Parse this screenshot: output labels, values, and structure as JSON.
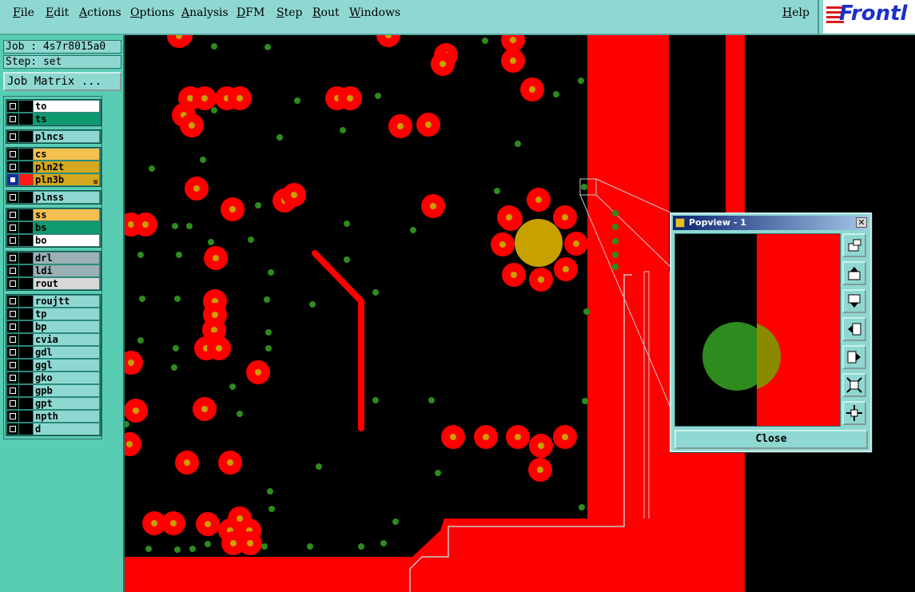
{
  "menu": {
    "file": "File",
    "edit": "Edit",
    "actions": "Actions",
    "options": "Options",
    "analysis": "Analysis",
    "dfm": "DFM",
    "step": "Step",
    "rout": "Rout",
    "windows": "Windows",
    "help": "Help"
  },
  "brand": {
    "logo_text": "Frontl",
    "logo_color": "#1a2fc8",
    "accent": "#d81a1a"
  },
  "job": {
    "job_line": "Job : 4s7r8015a0",
    "step_line": "Step: set",
    "matrix_button": "Job Matrix ..."
  },
  "layers": {
    "groups": [
      [
        {
          "name": "to",
          "color": "#ffffff",
          "checked": false
        },
        {
          "name": "ts",
          "color": "#0e9a6e",
          "checked": false
        }
      ],
      [
        {
          "name": "plncs",
          "color": "#8fd8d2",
          "checked": false
        }
      ],
      [
        {
          "name": "cs",
          "color": "#f4c050",
          "checked": false
        },
        {
          "name": "pln2t",
          "color": "#d4a820",
          "checked": false
        },
        {
          "name": "pln3b",
          "color": "#d4a820",
          "checked": true
        }
      ],
      [
        {
          "name": "plnss",
          "color": "#8fd8d2",
          "checked": false
        }
      ],
      [
        {
          "name": "ss",
          "color": "#f4c050",
          "checked": false
        },
        {
          "name": "bs",
          "color": "#0e9a6e",
          "checked": false
        },
        {
          "name": "bo",
          "color": "#ffffff",
          "checked": false
        }
      ],
      [
        {
          "name": "drl",
          "color": "#9ab0b4",
          "checked": false
        },
        {
          "name": "ldi",
          "color": "#9ab0b4",
          "checked": false
        },
        {
          "name": "rout",
          "color": "#d8d8d8",
          "checked": false
        }
      ],
      [
        {
          "name": "roujtt",
          "color": "#8fd8d2",
          "checked": false
        },
        {
          "name": "tp",
          "color": "#8fd8d2",
          "checked": false
        },
        {
          "name": "bp",
          "color": "#8fd8d2",
          "checked": false
        },
        {
          "name": "cvia",
          "color": "#8fd8d2",
          "checked": false
        },
        {
          "name": "gdl",
          "color": "#8fd8d2",
          "checked": false
        },
        {
          "name": "ggl",
          "color": "#8fd8d2",
          "checked": false
        },
        {
          "name": "gko",
          "color": "#8fd8d2",
          "checked": false
        },
        {
          "name": "gpb",
          "color": "#8fd8d2",
          "checked": false
        },
        {
          "name": "gpt",
          "color": "#8fd8d2",
          "checked": false
        },
        {
          "name": "npth",
          "color": "#8fd8d2",
          "checked": false
        },
        {
          "name": "d",
          "color": "#8fd8d2",
          "checked": false
        }
      ]
    ],
    "active_swatch_color": "#ff1a1a"
  },
  "canvas": {
    "copper_color": "#ff0000",
    "drill_color": "#2e8b1e",
    "pad_center_color": "#c8a000",
    "background": "#000000"
  },
  "popview": {
    "title": "Popview - 1",
    "close_label": "Close",
    "tools": [
      "zoom-window-icon",
      "pan-up-icon",
      "pan-down-icon",
      "pan-left-icon",
      "pan-right-icon",
      "zoom-out-icon",
      "zoom-in-icon"
    ]
  }
}
